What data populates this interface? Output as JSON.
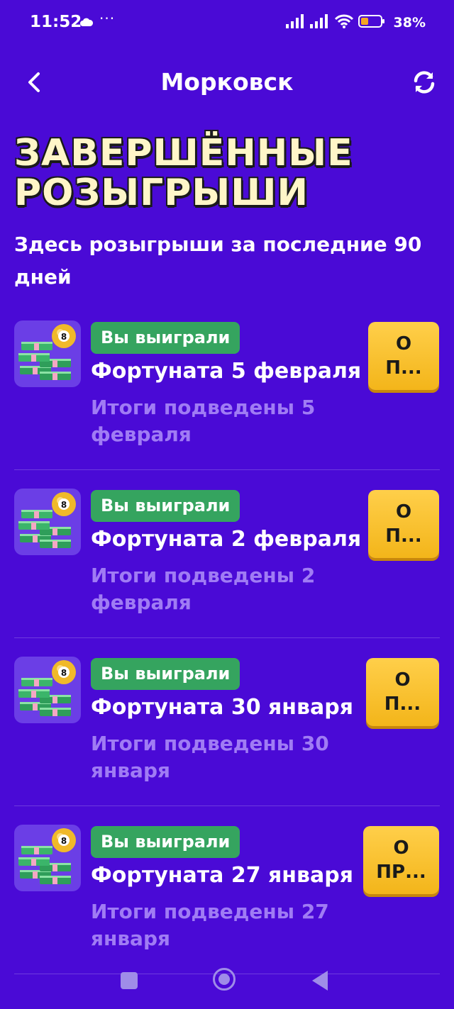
{
  "status_bar": {
    "time": "11:52",
    "dots": "···",
    "battery": "38%"
  },
  "header": {
    "city": "Морковск",
    "back_icon": "chevron-left-icon",
    "refresh_icon": "refresh-icon"
  },
  "page": {
    "title": "ЗАВЕРШЁННЫЕ РОЗЫГРЫШИ",
    "subtitle": "Здесь розыгрыши за последние 90 дней"
  },
  "draws": [
    {
      "badge": "Вы выиграли",
      "name": "Фортуната 5 февраля",
      "status": "Итоги подведены 5 февраля",
      "button": "О\nП..."
    },
    {
      "badge": "Вы выиграли",
      "name": "Фортуната 2 февраля",
      "status": "Итоги подведены 2 февраля",
      "button": "О\nП..."
    },
    {
      "badge": "Вы выиграли",
      "name": "Фортуната 30 января",
      "status": "Итоги подведены 30 января",
      "button": "О\nП..."
    },
    {
      "badge": "Вы выиграли",
      "name": "Фортуната 27 января",
      "status": "Итоги подведены 27 января",
      "button": "О\nПР..."
    }
  ],
  "colors": {
    "background": "#4a0ad6",
    "badge": "#35a45f",
    "button": "#f3b51a",
    "muted_text": "#a07cf4",
    "title": "#fff6c8"
  }
}
